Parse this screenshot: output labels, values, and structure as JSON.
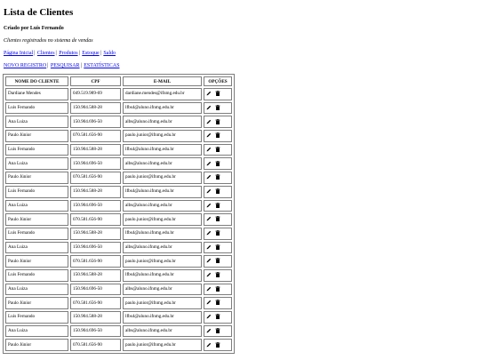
{
  "page": {
    "title": "Lista de Clientes",
    "subtitle": "Criado por Luis Fernando",
    "description": "Clientes registrados no sistema de vendas"
  },
  "nav": {
    "links": [
      "Página Inicial",
      "Clientes",
      "Produtos",
      "Estoque",
      "Saldo"
    ]
  },
  "actions": {
    "links": [
      "NOVO REGISTRO",
      "PESQUISAR",
      "ESTATÍSTICAS"
    ]
  },
  "table": {
    "headers": [
      "NOME DO CLIENTE",
      "CPF",
      "E-MAIL",
      "OPÇÕES"
    ],
    "rows": [
      {
        "name": "Dardiane Mendes",
        "cpf": "049.519.989-69",
        "email": "dardiane.mendes@ifnmg.edu.br"
      },
      {
        "name": "Luis Fernando",
        "cpf": "150.904.588-28",
        "email": "lfbs4@aluno.ifnmg.edu.br"
      },
      {
        "name": "Ana Luiza",
        "cpf": "150.904.696-50",
        "email": "albs@aluno.ifnmg.edu.br"
      },
      {
        "name": "Paulo Júnior",
        "cpf": "070.581.656-90",
        "email": "paulo.junior@ifnmg.edu.br"
      },
      {
        "name": "Luis Fernando",
        "cpf": "150.904.588-28",
        "email": "lfbs4@aluno.ifnmg.edu.br"
      },
      {
        "name": "Ana Luiza",
        "cpf": "150.904.696-50",
        "email": "albs@aluno.ifnmg.edu.br"
      },
      {
        "name": "Paulo Júnior",
        "cpf": "070.581.656-90",
        "email": "paulo.junior@ifnmg.edu.br"
      },
      {
        "name": "Luis Fernando",
        "cpf": "150.904.588-28",
        "email": "lfbs4@aluno.ifnmg.edu.br"
      },
      {
        "name": "Ana Luiza",
        "cpf": "150.904.696-50",
        "email": "albs@aluno.ifnmg.edu.br"
      },
      {
        "name": "Paulo Júnior",
        "cpf": "070.581.656-90",
        "email": "paulo.junior@ifnmg.edu.br"
      },
      {
        "name": "Luis Fernando",
        "cpf": "150.904.588-28",
        "email": "lfbs4@aluno.ifnmg.edu.br"
      },
      {
        "name": "Ana Luiza",
        "cpf": "150.904.696-50",
        "email": "albs@aluno.ifnmg.edu.br"
      },
      {
        "name": "Paulo Júnior",
        "cpf": "070.581.656-90",
        "email": "paulo.junior@ifnmg.edu.br"
      },
      {
        "name": "Luis Fernando",
        "cpf": "150.904.588-28",
        "email": "lfbs4@aluno.ifnmg.edu.br"
      },
      {
        "name": "Ana Luiza",
        "cpf": "150.904.696-50",
        "email": "albs@aluno.ifnmg.edu.br"
      },
      {
        "name": "Paulo Júnior",
        "cpf": "070.581.656-90",
        "email": "paulo.junior@ifnmg.edu.br"
      },
      {
        "name": "Luis Fernando",
        "cpf": "150.904.588-28",
        "email": "lfbs4@aluno.ifnmg.edu.br"
      },
      {
        "name": "Ana Luiza",
        "cpf": "150.904.696-50",
        "email": "albs@aluno.ifnmg.edu.br"
      },
      {
        "name": "Paulo Júnior",
        "cpf": "070.581.656-90",
        "email": "paulo.junior@ifnmg.edu.br"
      }
    ],
    "row_icons": [
      "pencil-icon",
      "trash-icon"
    ]
  },
  "colors": {
    "link": "#0000ee",
    "border": "#7d7d7d"
  }
}
